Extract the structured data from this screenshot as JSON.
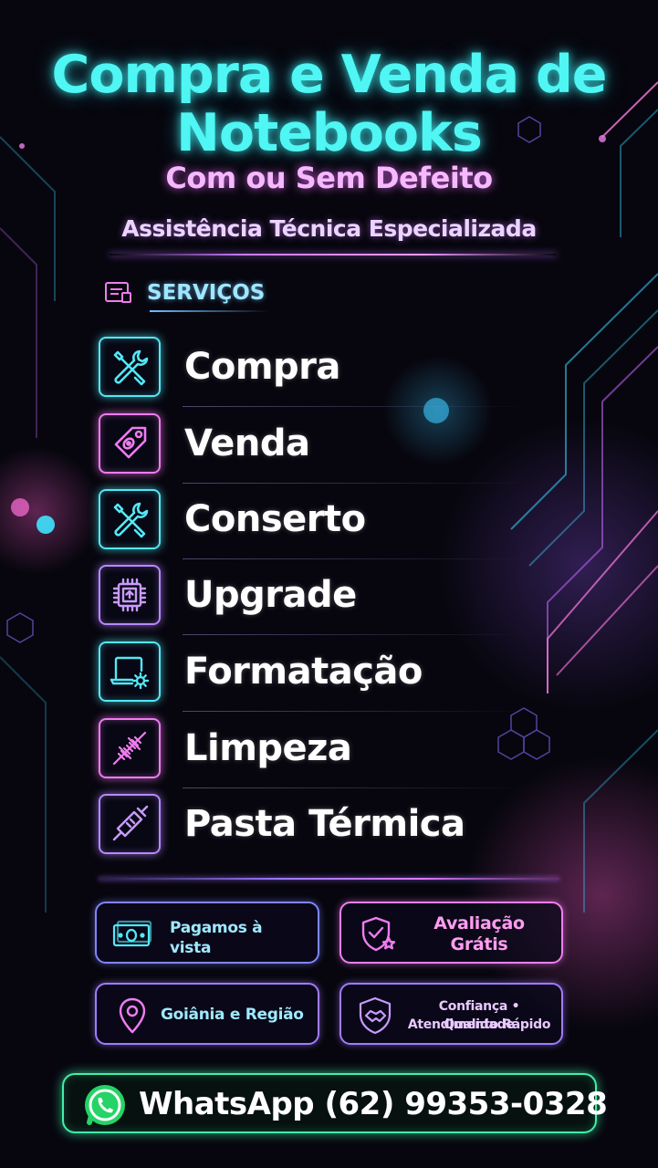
{
  "colors": {
    "cyan": "#4ff6f3",
    "pink": "#f07cf0",
    "violet": "#b789ff",
    "green": "#41f0a8",
    "background": "#07060e"
  },
  "header": {
    "title_line1": "Compra e Venda de",
    "title_line2": "Notebooks",
    "subtitle": "Com ou Sem Defeito",
    "tagline": "Assistência Técnica Especializada"
  },
  "services": {
    "heading": "SERVIÇOS",
    "heading_icon": "list-card-icon",
    "items": [
      {
        "label": "Compra",
        "icon": "tools-icon",
        "accent": "cyan"
      },
      {
        "label": "Venda",
        "icon": "price-tag-icon",
        "accent": "pink"
      },
      {
        "label": "Conserto",
        "icon": "tools-icon",
        "accent": "cyan"
      },
      {
        "label": "Upgrade",
        "icon": "chip-icon",
        "accent": "violet"
      },
      {
        "label": "Formatação",
        "icon": "laptop-gear-icon",
        "accent": "cyan"
      },
      {
        "label": "Limpeza",
        "icon": "brush-icon",
        "accent": "pink"
      },
      {
        "label": "Pasta Térmica",
        "icon": "syringe-icon",
        "accent": "violet"
      }
    ]
  },
  "badges": {
    "payment": {
      "label": "Pagamos à vista",
      "icon": "banknote-icon"
    },
    "evaluation": {
      "line1": "Avaliação",
      "line2": "Grátis",
      "icon": "shield-star-icon"
    },
    "location": {
      "label": "Goiânia e Região",
      "icon": "location-pin-icon"
    },
    "trust": {
      "line1": "Confiança • Qualidade",
      "line2": "Atendimento Rápido",
      "icon": "shield-handshake-icon"
    }
  },
  "contact": {
    "label": "WhatsApp (62) 99353-0328",
    "icon": "whatsapp-icon"
  }
}
